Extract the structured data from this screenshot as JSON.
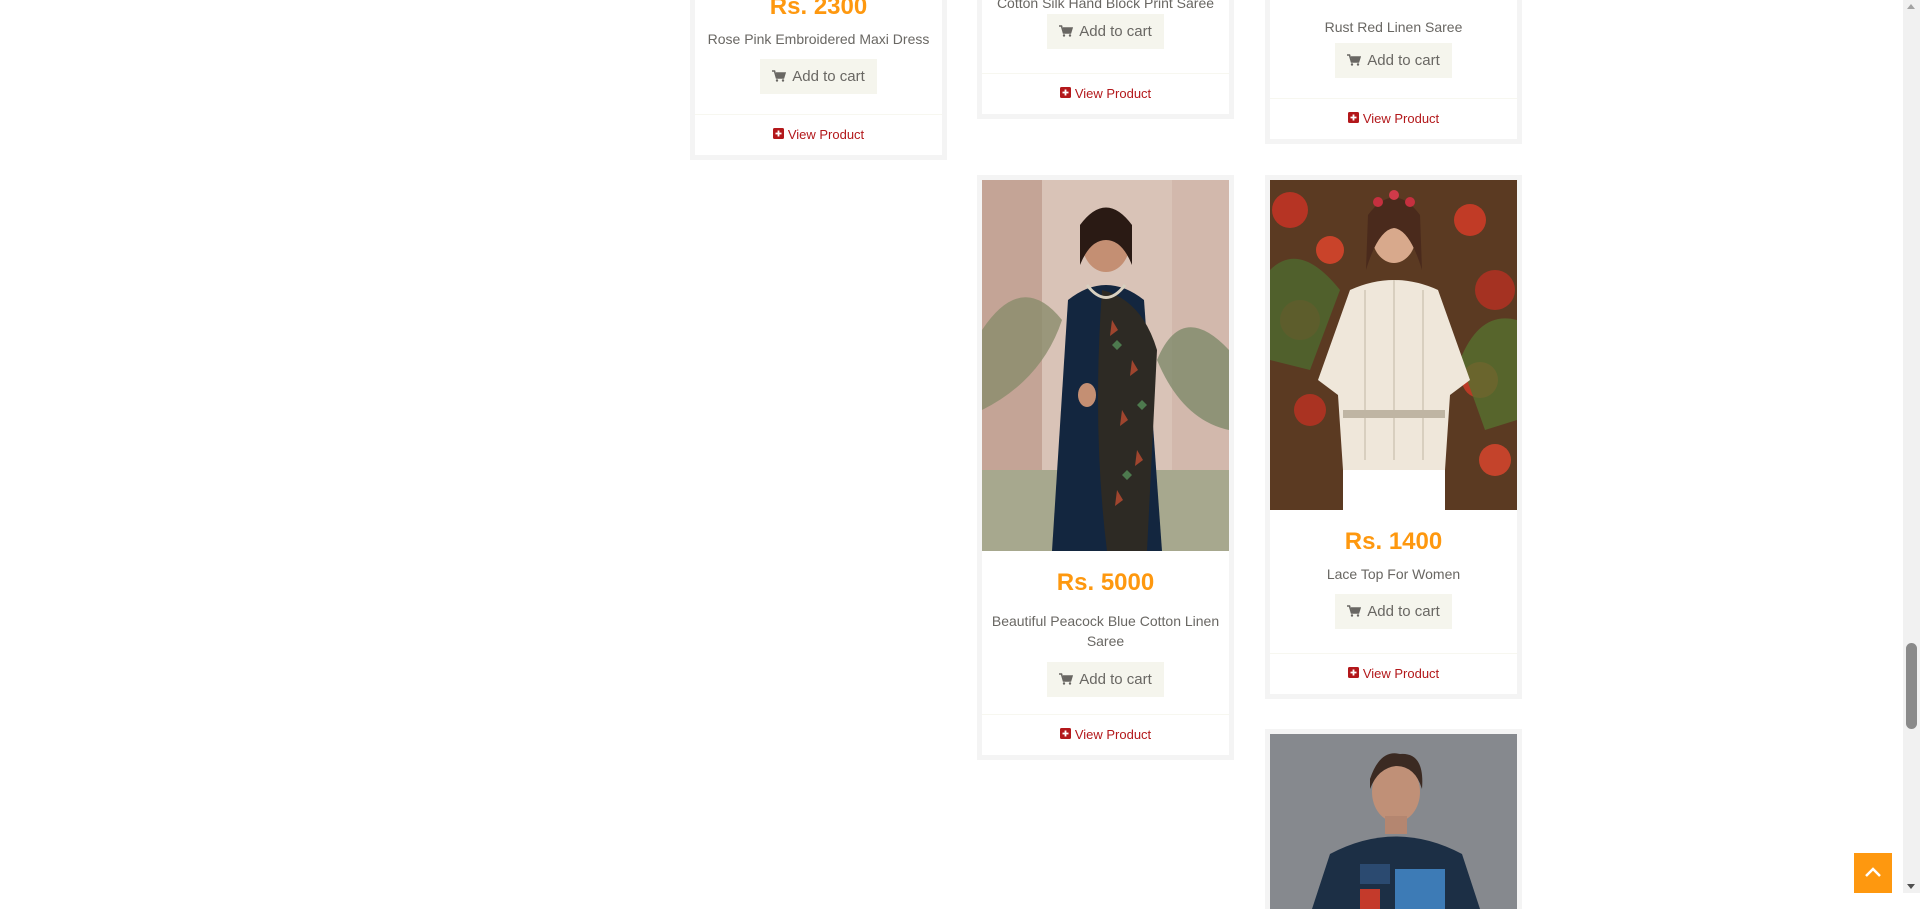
{
  "products": [
    {
      "price": "Rs. 2300",
      "name": "Rose Pink Embroidered Maxi Dress",
      "add_to_cart": "Add to cart",
      "view_product": "View Product"
    },
    {
      "price": "",
      "name": "Cotton Silk Hand Block Print Saree",
      "add_to_cart": "Add to cart",
      "view_product": "View Product"
    },
    {
      "price": "",
      "name": "Rust Red Linen Saree",
      "add_to_cart": "Add to cart",
      "view_product": "View Product"
    },
    {
      "price": "Rs. 5000",
      "name": "Beautiful Peacock Blue Cotton Linen Saree",
      "add_to_cart": "Add to cart",
      "view_product": "View Product"
    },
    {
      "price": "Rs. 1400",
      "name": "Lace Top For Women",
      "add_to_cart": "Add to cart",
      "view_product": "View Product"
    }
  ],
  "colors": {
    "accent": "#fe980f",
    "link": "#b3181b",
    "text": "#696763",
    "button_bg": "#f5f5ed",
    "card_border": "#f4f4f4"
  },
  "icons": {
    "cart": "shopping-cart-icon",
    "view": "plus-square-icon",
    "scroll_up": "chevron-up-icon"
  }
}
